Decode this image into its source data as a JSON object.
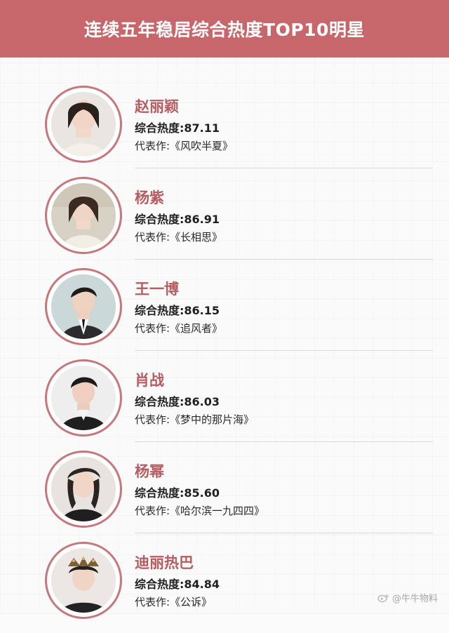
{
  "header": {
    "title": "连续五年稳居综合热度TOP10明星"
  },
  "items": [
    {
      "name": "赵丽颖",
      "score_label": "综合热度:87.11",
      "work_label": "代表作:《风吹半夏》",
      "avatar_desc_color": "#d8d0c9"
    },
    {
      "name": "杨紫",
      "score_label": "综合热度:86.91",
      "work_label": "代表作:《长相思》",
      "avatar_desc_color": "#d8d0c9"
    },
    {
      "name": "王一博",
      "score_label": "综合热度:86.15",
      "work_label": "代表作:《追风者》",
      "avatar_desc_color": "#d8d0c9"
    },
    {
      "name": "肖战",
      "score_label": "综合热度:86.03",
      "work_label": "代表作:《梦中的那片海》",
      "avatar_desc_color": "#d8d0c9"
    },
    {
      "name": "杨幂",
      "score_label": "综合热度:85.60",
      "work_label": "代表作:《哈尔滨一九四四》",
      "avatar_desc_color": "#d8d0c9"
    },
    {
      "name": "迪丽热巴",
      "score_label": "综合热度:84.84",
      "work_label": "代表作:《公诉》",
      "avatar_desc_color": "#d8d0c9"
    }
  ],
  "watermark": {
    "text": "@牛牛物料"
  },
  "colors": {
    "header_bg": "#c8676b",
    "name_text": "#b55d61",
    "ring": "#c5777b"
  }
}
